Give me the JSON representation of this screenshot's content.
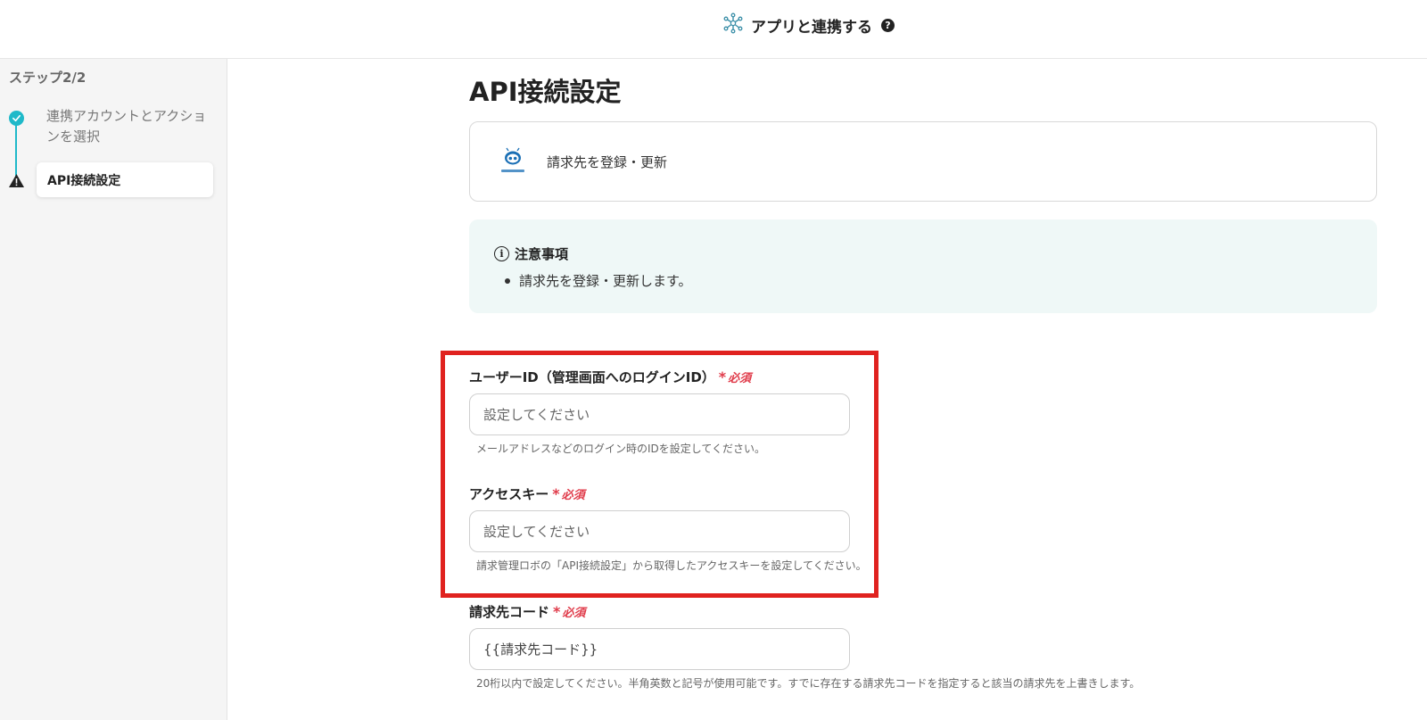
{
  "header": {
    "title": "アプリと連携する",
    "help_icon": "question-circle-icon",
    "app_icon": "network-nodes-icon"
  },
  "sidebar": {
    "step_count": "ステップ2/2",
    "steps": [
      {
        "label": "連携アカウントとアクションを選択",
        "status": "completed",
        "icon": "check-circle-icon"
      },
      {
        "label": "API接続設定",
        "status": "warning",
        "icon": "warning-triangle-icon"
      }
    ]
  },
  "main": {
    "title": "API接続設定",
    "app_card": {
      "logo": "invoice-robo-logo",
      "action": "請求先を登録・更新"
    },
    "notice": {
      "title": "注意事項",
      "items": [
        "請求先を登録・更新します。"
      ]
    },
    "fields": [
      {
        "label": "ユーザーID（管理画面へのログインID）",
        "required": "必須",
        "placeholder": "設定してください",
        "value": "",
        "hint": "メールアドレスなどのログイン時のIDを設定してください。"
      },
      {
        "label": "アクセスキー",
        "required": "必須",
        "placeholder": "設定してください",
        "value": "",
        "hint": "請求管理ロボの「API接続設定」から取得したアクセスキーを設定してください。"
      },
      {
        "label": "請求先コード",
        "required": "必須",
        "placeholder": "",
        "value": "{{請求先コード}}",
        "hint": "20桁以内で設定してください。半角英数と記号が使用可能です。すでに存在する請求先コードを指定すると該当の請求先を上書きします。"
      }
    ]
  },
  "colors": {
    "accent": "#1fb9c9",
    "required": "#e03b4a",
    "highlight": "#e0221f",
    "notice_bg": "#eff8f7"
  }
}
